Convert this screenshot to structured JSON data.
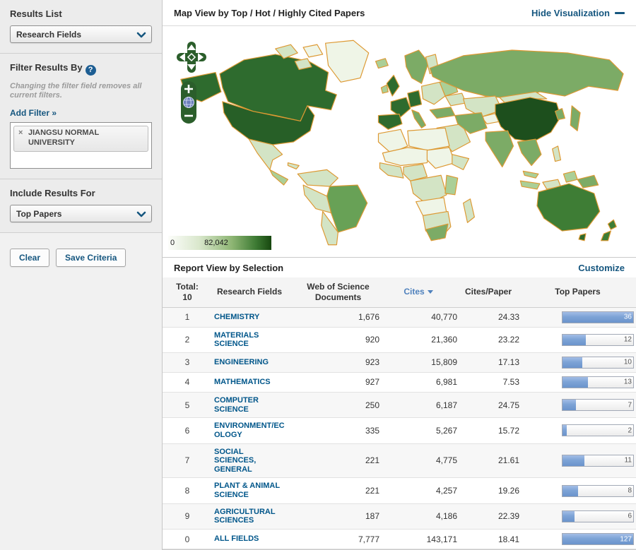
{
  "colors": {
    "accent_link_blue": "#15567f",
    "field_link_blue": "#00568a",
    "cites_sort_blue": "#4f81bd",
    "map_border_orange": "#dd9933",
    "map_dark_green": "#1d4f1d",
    "control_green": "#2b5e2b",
    "sidebar_gray": "#ececec",
    "bar_fill_blue": "#7da3d6"
  },
  "icons": {
    "help": "?",
    "remove_tag": "x",
    "chevron_down": "v",
    "hide_minus": "-",
    "sort_desc": "▼",
    "pan_control": "arrows-up-down-left-right",
    "zoom_plus": "+",
    "zoom_minus": "−",
    "globe": "globe"
  },
  "sidebar": {
    "results_list": {
      "heading": "Results List",
      "selected": "Research Fields"
    },
    "filter": {
      "heading": "Filter Results By",
      "note": "Changing the filter field removes all current filters.",
      "add_filter_label": "Add Filter »",
      "active_filters": [
        {
          "label": "JIANGSU NORMAL UNIVERSITY",
          "remove_glyph": "x"
        }
      ]
    },
    "include": {
      "heading": "Include Results For",
      "selected": "Top Papers"
    },
    "buttons": {
      "clear": "Clear",
      "save": "Save Criteria"
    }
  },
  "map_view": {
    "title": "Map View by Top / Hot / Highly Cited Papers",
    "hide_link": "Hide Visualization",
    "legend": {
      "min": "0",
      "max": "82,042"
    }
  },
  "report": {
    "title": "Report View by Selection",
    "customize_link": "Customize",
    "table": {
      "total_label": "Total:",
      "total_count": "10",
      "col_field": "Research Fields",
      "col_docs": "Web of Science Documents",
      "col_cites": "Cites",
      "col_cpp": "Cites/Paper",
      "col_top": "Top Papers",
      "sorted_by": "Cites",
      "bar_max": 36,
      "rows": [
        {
          "rank": "1",
          "field": "CHEMISTRY",
          "docs": "1,676",
          "cites": "40,770",
          "cpp": "24.33",
          "top_papers": "36"
        },
        {
          "rank": "2",
          "field": "MATERIALS SCIENCE",
          "docs": "920",
          "cites": "21,360",
          "cpp": "23.22",
          "top_papers": "12"
        },
        {
          "rank": "3",
          "field": "ENGINEERING",
          "docs": "923",
          "cites": "15,809",
          "cpp": "17.13",
          "top_papers": "10"
        },
        {
          "rank": "4",
          "field": "MATHEMATICS",
          "docs": "927",
          "cites": "6,981",
          "cpp": "7.53",
          "top_papers": "13"
        },
        {
          "rank": "5",
          "field": "COMPUTER SCIENCE",
          "docs": "250",
          "cites": "6,187",
          "cpp": "24.75",
          "top_papers": "7"
        },
        {
          "rank": "6",
          "field": "ENVIRONMENT/ECOLOGY",
          "docs": "335",
          "cites": "5,267",
          "cpp": "15.72",
          "top_papers": "2"
        },
        {
          "rank": "7",
          "field": "SOCIAL SCIENCES, GENERAL",
          "docs": "221",
          "cites": "4,775",
          "cpp": "21.61",
          "top_papers": "11"
        },
        {
          "rank": "8",
          "field": "PLANT & ANIMAL SCIENCE",
          "docs": "221",
          "cites": "4,257",
          "cpp": "19.26",
          "top_papers": "8"
        },
        {
          "rank": "9",
          "field": "AGRICULTURAL SCIENCES",
          "docs": "187",
          "cites": "4,186",
          "cpp": "22.39",
          "top_papers": "6"
        },
        {
          "rank": "0",
          "field": "ALL FIELDS",
          "docs": "7,777",
          "cites": "143,171",
          "cpp": "18.41",
          "top_papers": "127"
        }
      ]
    }
  }
}
